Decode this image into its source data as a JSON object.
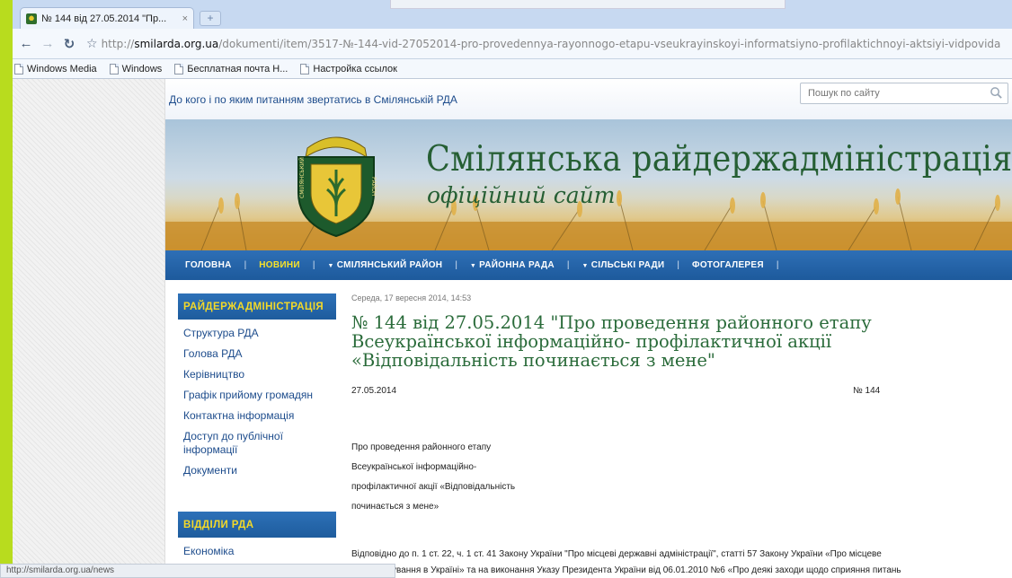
{
  "browser": {
    "tab_title": "№ 144 від 27.05.2014 \"Пр...",
    "tab_close": "×",
    "new_tab": "+",
    "url_prefix": "http://",
    "url_domain": "smilarda.org.ua",
    "url_path": "/dokumenti/item/3517-№-144-vid-27052014-pro-provedennya-rayonnogo-etapu-vseukrayinskoyi-informatsiyno-profilaktichnoyi-aktsiyi-vidpovida",
    "bookmarks": [
      "Windows Media",
      "Windows",
      "Бесплатная почта Н...",
      "Настройка ссылок"
    ],
    "status_url": "http://smilarda.org.ua/news"
  },
  "site": {
    "top_link": "До кого і по яким питанням звертатись в Смілянській РДА",
    "search_placeholder": "Пошук по сайту",
    "title": "Смілянська райдержадміністрація",
    "subtitle": "офіційний сайт",
    "emblem_left": "СМІЛЯНСЬКИЙ",
    "emblem_right": "РАЙОН",
    "nav": [
      {
        "label": "ГОЛОВНА",
        "active": false,
        "arrow": false
      },
      {
        "label": "НОВИНИ",
        "active": true,
        "arrow": false
      },
      {
        "label": "СМІЛЯНСЬКИЙ РАЙОН",
        "active": false,
        "arrow": true
      },
      {
        "label": "РАЙОННА РАДА",
        "active": false,
        "arrow": true
      },
      {
        "label": "СІЛЬСЬКІ РАДИ",
        "active": false,
        "arrow": true
      },
      {
        "label": "ФОТОГАЛЕРЕЯ",
        "active": false,
        "arrow": false
      }
    ],
    "nav_separator": "|"
  },
  "sidebar": {
    "heading1": "РАЙДЕРЖАДМІНІСТРАЦІЯ",
    "items1": [
      "Структура РДА",
      "Голова РДА",
      "Керівництво",
      "Графік прийому громадян",
      "Контактна інформація",
      "Доступ до публічної інформації",
      "Документи"
    ],
    "heading2": "ВІДДІЛИ РДА",
    "items2": [
      "Економіка"
    ]
  },
  "article": {
    "datetime": "Середа, 17 вересня 2014, 14:53",
    "title": "№ 144 від 27.05.2014 \"Про проведення районного етапу Всеукраїнської інформаційно- профілактичної акції «Відповідальність починається з мене\"",
    "doc_date": "27.05.2014",
    "doc_number": "№ 144",
    "subject_lines": [
      "Про проведення районного етапу",
      "Всеукраїнської інформаційно-",
      "профілактичної акції «Відповідальність",
      "починається з мене»"
    ],
    "body_line1": "Відповідно до п. 1 ст. 22, ч. 1 ст. 41 Закону України \"Про місцеві державні адміністрації\", статті 57 Закону України «Про місцеве",
    "body_line2": "самоврядування в Україні» та на виконання Указу Президента України від 06.01.2010 №6 «Про деякі заходи щодо сприяння питань"
  }
}
